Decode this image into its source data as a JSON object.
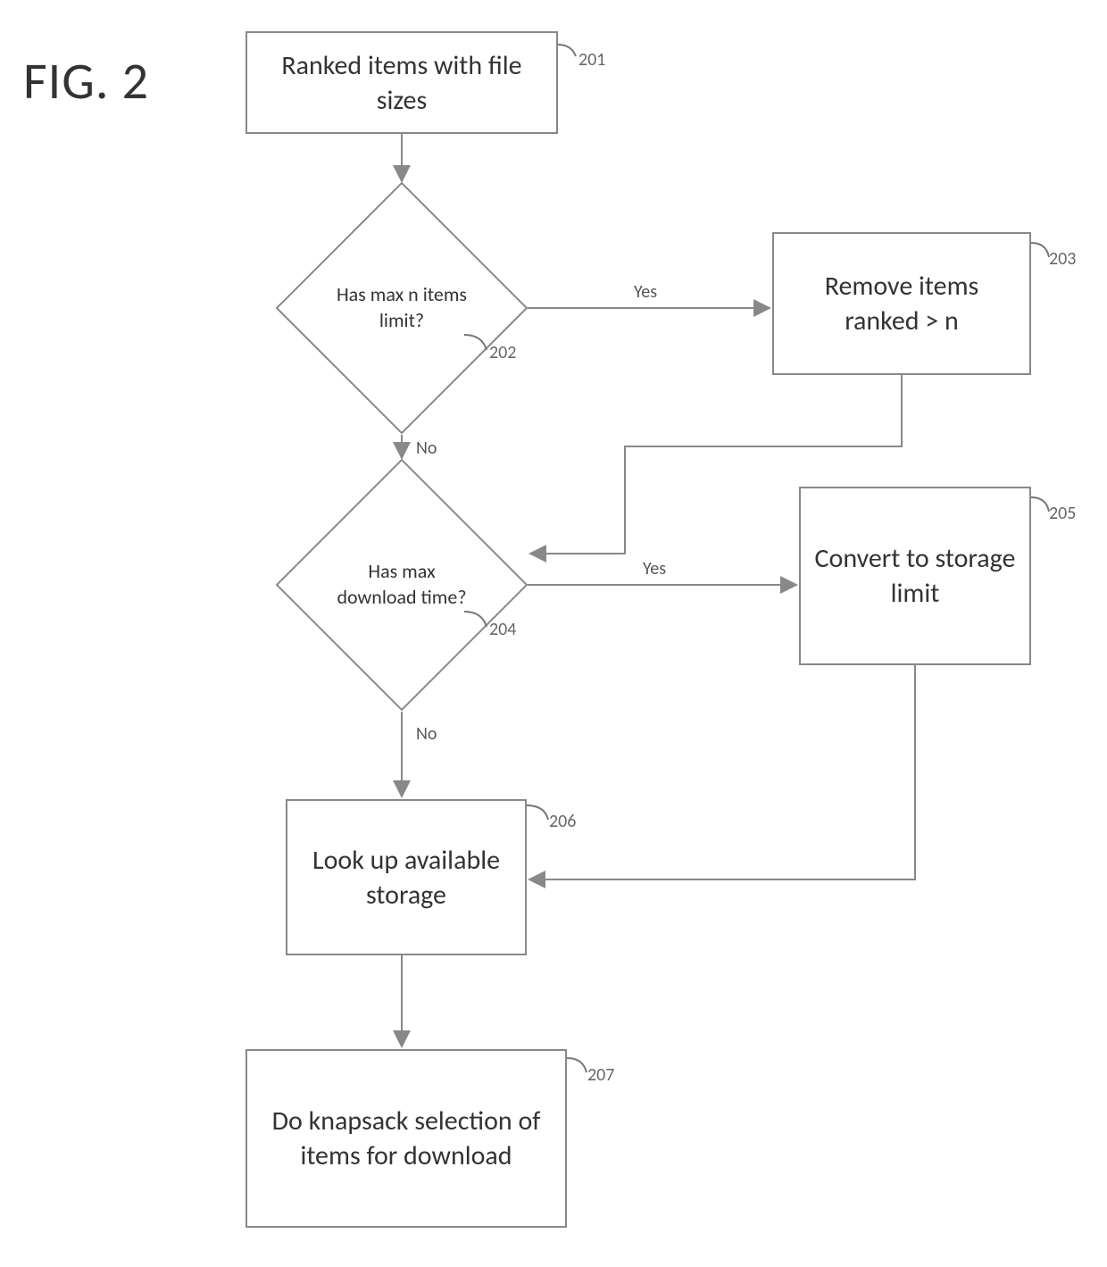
{
  "figure_label": "FIG. 2",
  "nodes": {
    "n201": {
      "text": "Ranked items with file sizes",
      "ref": "201"
    },
    "n202": {
      "text": "Has max n items limit?",
      "ref": "202"
    },
    "n203": {
      "text": "Remove items ranked > n",
      "ref": "203"
    },
    "n204": {
      "text": "Has max download time?",
      "ref": "204"
    },
    "n205": {
      "text": "Convert to storage limit",
      "ref": "205"
    },
    "n206": {
      "text": "Look up available storage",
      "ref": "206"
    },
    "n207": {
      "text": "Do knapsack selection of items for download",
      "ref": "207"
    }
  },
  "edge_labels": {
    "e202_yes": "Yes",
    "e202_no": "No",
    "e204_yes": "Yes",
    "e204_no": "No"
  }
}
